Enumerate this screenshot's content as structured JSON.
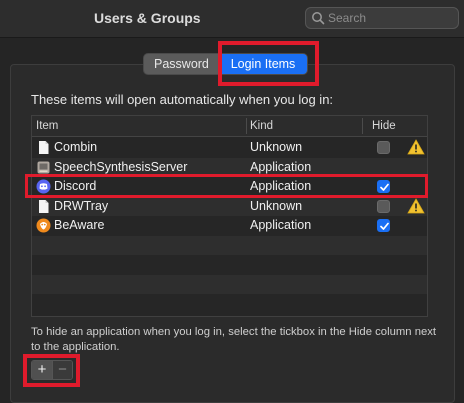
{
  "window": {
    "title": "Users & Groups"
  },
  "search": {
    "placeholder": "Search"
  },
  "tabs": [
    {
      "label": "Password",
      "active": false
    },
    {
      "label": "Login Items",
      "active": true
    }
  ],
  "intro_text": "These items will open automatically when you log in:",
  "table": {
    "headers": {
      "item": "Item",
      "kind": "Kind",
      "hide": "Hide"
    },
    "rows": [
      {
        "name": "Combin",
        "kind": "Unknown",
        "hide": false,
        "warning": true,
        "icon": "document-icon"
      },
      {
        "name": "SpeechSynthesisServer",
        "kind": "Application",
        "hide": false,
        "warning": false,
        "icon": "app-icon"
      },
      {
        "name": "Discord",
        "kind": "Application",
        "hide": true,
        "warning": false,
        "icon": "discord-icon"
      },
      {
        "name": "DRWTray",
        "kind": "Unknown",
        "hide": false,
        "warning": true,
        "icon": "document-icon"
      },
      {
        "name": "BeAware",
        "kind": "Application",
        "hide": true,
        "warning": false,
        "icon": "beaware-icon"
      }
    ]
  },
  "help_text": "To hide an application when you log in, select the tickbox in the Hide column next to the application.",
  "buttons": {
    "add": "+",
    "remove": "−"
  },
  "colors": {
    "accent": "#1a6ff4",
    "highlight": "#e01b2c",
    "warning": "#f2c230"
  }
}
